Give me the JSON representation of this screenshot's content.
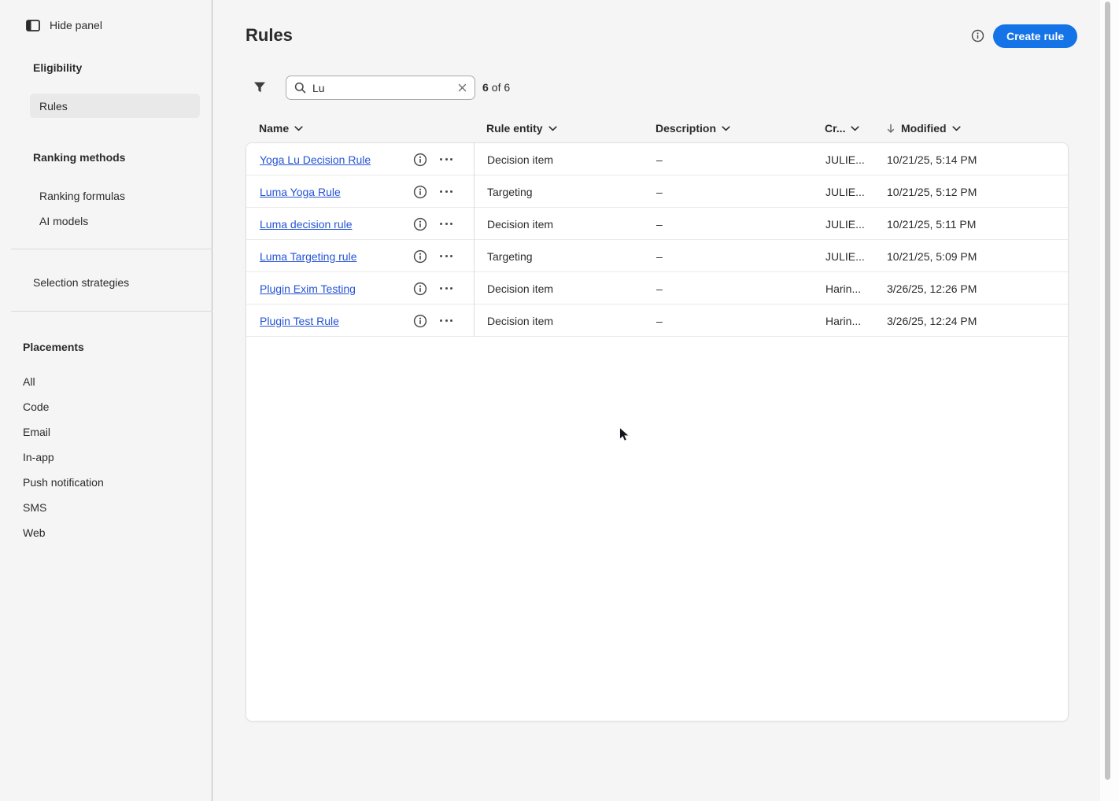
{
  "colors": {
    "accent_blue": "#1473e6",
    "link_blue": "#2553d5"
  },
  "sidebar": {
    "hide_panel_label": "Hide panel",
    "eligibility_title": "Eligibility",
    "rules_item": "Rules",
    "ranking_title": "Ranking methods",
    "ranking_formulas": "Ranking formulas",
    "ai_models": "AI models",
    "selection_strategies": "Selection strategies",
    "placements_title": "Placements",
    "placements": [
      "All",
      "Code",
      "Email",
      "In-app",
      "Push notification",
      "SMS",
      "Web"
    ]
  },
  "header": {
    "title": "Rules",
    "create_button_label": "Create rule"
  },
  "toolbar": {
    "search_value": "Lu",
    "count_number": "6",
    "count_rest": "of 6"
  },
  "table": {
    "columns": [
      {
        "label": "Name"
      },
      {
        "label": "Rule entity"
      },
      {
        "label": "Description"
      },
      {
        "label": "Cr..."
      },
      {
        "label": "Modified",
        "sorted": "descending"
      }
    ],
    "rows": [
      {
        "name": "Yoga Lu Decision Rule",
        "entity": "Decision item",
        "description": "–",
        "created_by": "JULIE...",
        "modified": "10/21/25, 5:14 PM"
      },
      {
        "name": "Luma Yoga Rule",
        "entity": "Targeting",
        "description": "–",
        "created_by": "JULIE...",
        "modified": "10/21/25, 5:12 PM"
      },
      {
        "name": "Luma decision rule",
        "entity": "Decision item",
        "description": "–",
        "created_by": "JULIE...",
        "modified": "10/21/25, 5:11 PM"
      },
      {
        "name": "Luma Targeting rule",
        "entity": "Targeting",
        "description": "–",
        "created_by": "JULIE...",
        "modified": "10/21/25, 5:09 PM"
      },
      {
        "name": "Plugin Exim Testing",
        "entity": "Decision item",
        "description": "–",
        "created_by": "Harin...",
        "modified": "3/26/25, 12:26 PM"
      },
      {
        "name": "Plugin Test Rule",
        "entity": "Decision item",
        "description": "–",
        "created_by": "Harin...",
        "modified": "3/26/25, 12:24 PM"
      }
    ]
  }
}
